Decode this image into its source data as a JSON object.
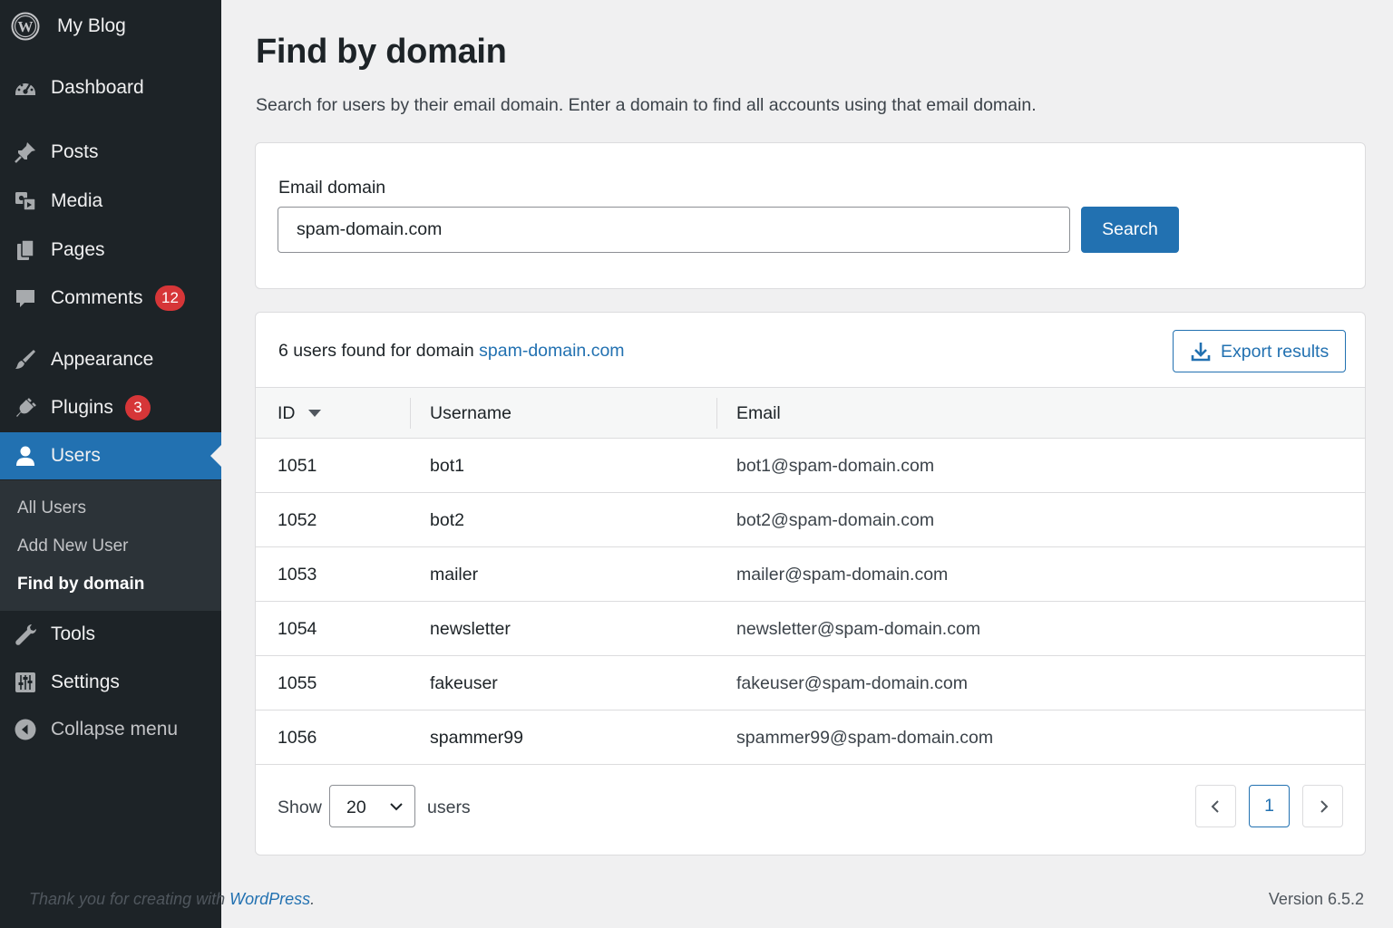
{
  "site": {
    "name": "My Blog",
    "logo_icon": "wordpress-logo-icon"
  },
  "sidebar": {
    "items": [
      {
        "key": "dashboard",
        "label": "Dashboard",
        "icon": "dashboard-icon"
      },
      {
        "key": "posts",
        "label": "Posts",
        "icon": "pin-icon"
      },
      {
        "key": "media",
        "label": "Media",
        "icon": "media-icon"
      },
      {
        "key": "pages",
        "label": "Pages",
        "icon": "pages-icon"
      },
      {
        "key": "comments",
        "label": "Comments",
        "icon": "comment-icon",
        "badge": "12"
      },
      {
        "key": "appearance",
        "label": "Appearance",
        "icon": "brush-icon"
      },
      {
        "key": "plugins",
        "label": "Plugins",
        "icon": "plug-icon",
        "badge": "3"
      },
      {
        "key": "users",
        "label": "Users",
        "icon": "user-icon",
        "active": true
      },
      {
        "key": "tools",
        "label": "Tools",
        "icon": "wrench-icon"
      },
      {
        "key": "settings",
        "label": "Settings",
        "icon": "sliders-icon"
      },
      {
        "key": "collapse",
        "label": "Collapse menu",
        "icon": "collapse-arrow-icon"
      }
    ],
    "submenu": [
      {
        "label": "All Users"
      },
      {
        "label": "Add New User"
      },
      {
        "label": "Find by domain",
        "current": true
      }
    ]
  },
  "page": {
    "title": "Find by domain",
    "description": "Search for users by their email domain. Enter a domain to find all accounts using that email domain."
  },
  "search": {
    "label": "Email domain",
    "value": "spam-domain.com",
    "button": "Search"
  },
  "results": {
    "summary_prefix": "6 users found for domain ",
    "domain": "spam-domain.com",
    "export_label": "Export results",
    "columns": [
      "ID",
      "Username",
      "Email"
    ],
    "sorted_by": "ID",
    "rows": [
      {
        "id": "1051",
        "username": "bot1",
        "email": "bot1@spam-domain.com"
      },
      {
        "id": "1052",
        "username": "bot2",
        "email": "bot2@spam-domain.com"
      },
      {
        "id": "1053",
        "username": "mailer",
        "email": "mailer@spam-domain.com"
      },
      {
        "id": "1054",
        "username": "newsletter",
        "email": "newsletter@spam-domain.com"
      },
      {
        "id": "1055",
        "username": "fakeuser",
        "email": "fakeuser@spam-domain.com"
      },
      {
        "id": "1056",
        "username": "spammer99",
        "email": "spammer99@spam-domain.com"
      }
    ],
    "show_label": "Show",
    "per_page": "20",
    "users_label": "users",
    "current_page": "1"
  },
  "footer": {
    "thanks_prefix": "Thank you for creating with ",
    "thanks_link": "WordPress",
    "thanks_suffix": ".",
    "version": "Version 6.5.2"
  },
  "colors": {
    "sidebar_bg": "#1d2327",
    "submenu_bg": "#2c3338",
    "accent": "#2271b1",
    "badge": "#d63638",
    "page_bg": "#f0f0f1"
  }
}
